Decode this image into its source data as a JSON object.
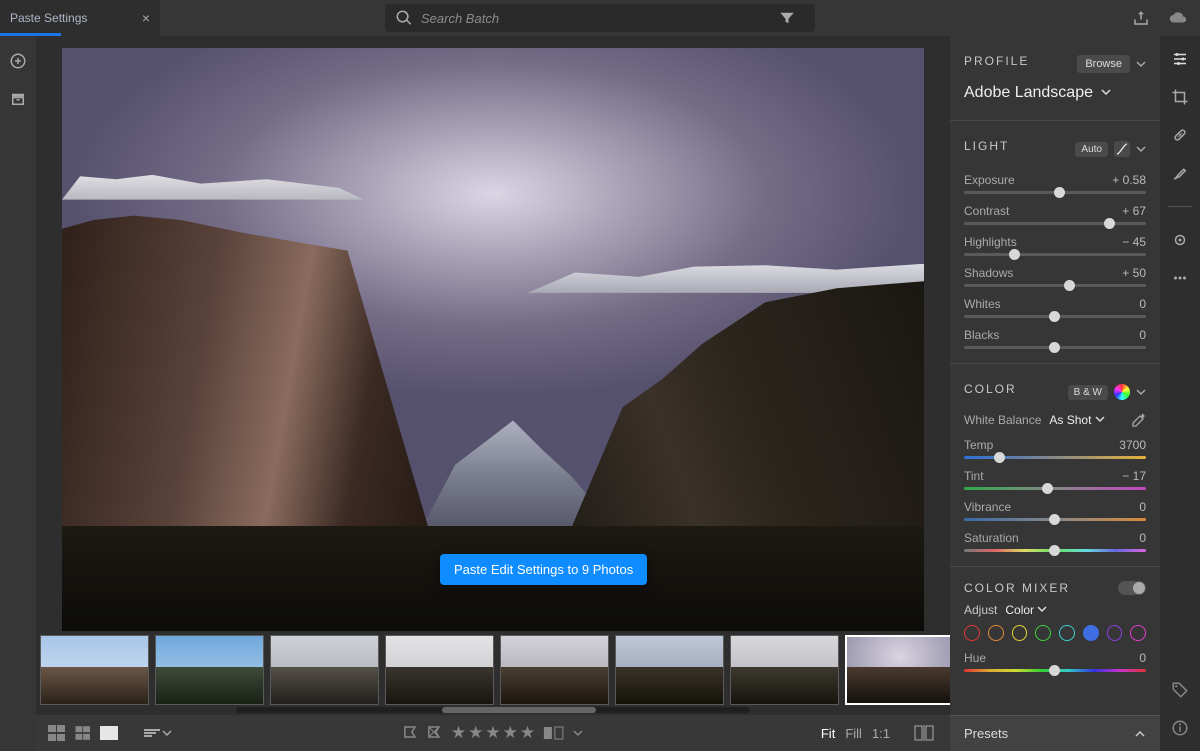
{
  "topbar": {
    "tab_title": "Paste Settings",
    "search_placeholder": "Search Batch"
  },
  "tooltip": {
    "text": "Paste Edit Settings to 9 Photos"
  },
  "zoom": {
    "fit": "Fit",
    "fill": "Fill",
    "one": "1:1"
  },
  "profile": {
    "title": "PROFILE",
    "browse": "Browse",
    "selected": "Adobe Landscape"
  },
  "light": {
    "title": "LIGHT",
    "auto": "Auto",
    "sliders": {
      "exposure": {
        "label": "Exposure",
        "value": "+ 0.58",
        "pos": 53
      },
      "contrast": {
        "label": "Contrast",
        "value": "+ 67",
        "pos": 80
      },
      "highlights": {
        "label": "Highlights",
        "value": "− 45",
        "pos": 28
      },
      "shadows": {
        "label": "Shadows",
        "value": "+ 50",
        "pos": 58
      },
      "whites": {
        "label": "Whites",
        "value": "0",
        "pos": 50
      },
      "blacks": {
        "label": "Blacks",
        "value": "0",
        "pos": 50
      }
    }
  },
  "color": {
    "title": "COLOR",
    "bw": "B & W",
    "wb_label": "White Balance",
    "wb_value": "As Shot",
    "sliders": {
      "temp": {
        "label": "Temp",
        "value": "3700",
        "pos": 20
      },
      "tint": {
        "label": "Tint",
        "value": "− 17",
        "pos": 46
      },
      "vibrance": {
        "label": "Vibrance",
        "value": "0",
        "pos": 50
      },
      "saturation": {
        "label": "Saturation",
        "value": "0",
        "pos": 50
      }
    }
  },
  "mixer": {
    "title": "COLOR MIXER",
    "adjust_label": "Adjust",
    "adjust_value": "Color",
    "hue": {
      "label": "Hue",
      "value": "0",
      "pos": 50
    },
    "swatches": [
      "#e23838",
      "#e28a38",
      "#e2cf38",
      "#3ecf3e",
      "#3ecfcf",
      "#3e6ee2",
      "#8a3ee2",
      "#e23ecf"
    ],
    "selected_swatch": 5
  },
  "presets": {
    "label": "Presets"
  },
  "thumbs": [
    {
      "sky": "linear-gradient(#a8c6e8,#d8e4f0)",
      "mtn": "linear-gradient(#6a5646,#2a2218)"
    },
    {
      "sky": "linear-gradient(#6fa8dc,#bcd8ef)",
      "mtn": "linear-gradient(#3e4a3a,#1a2216)"
    },
    {
      "sky": "linear-gradient(#cfd3d8,#9aa0a6)",
      "mtn": "linear-gradient(#555048,#22201c)"
    },
    {
      "sky": "linear-gradient(#e4e4e6,#bcbcc0)",
      "mtn": "linear-gradient(#3a362e,#181510)"
    },
    {
      "sky": "linear-gradient(#d4d2d8,#9a98a2)",
      "mtn": "linear-gradient(#4a3e32,#1c160e)"
    },
    {
      "sky": "linear-gradient(#bfc8d8,#8a92a6)",
      "mtn": "linear-gradient(#3a3428,#151208)"
    },
    {
      "sky": "linear-gradient(#d8d8dc,#a8a8b0)",
      "mtn": "linear-gradient(#3e3a30,#16140e)"
    },
    {
      "sky": "radial-gradient(ellipse at 50% 30%,#d8d4e0,#8a86a0)",
      "mtn": "linear-gradient(#4a3a30,#14100c)"
    },
    {
      "sky": "linear-gradient(#343a52,#586082)",
      "mtn": "linear-gradient(#2a2620,#0c0a08)"
    }
  ],
  "selected_thumb": 7
}
